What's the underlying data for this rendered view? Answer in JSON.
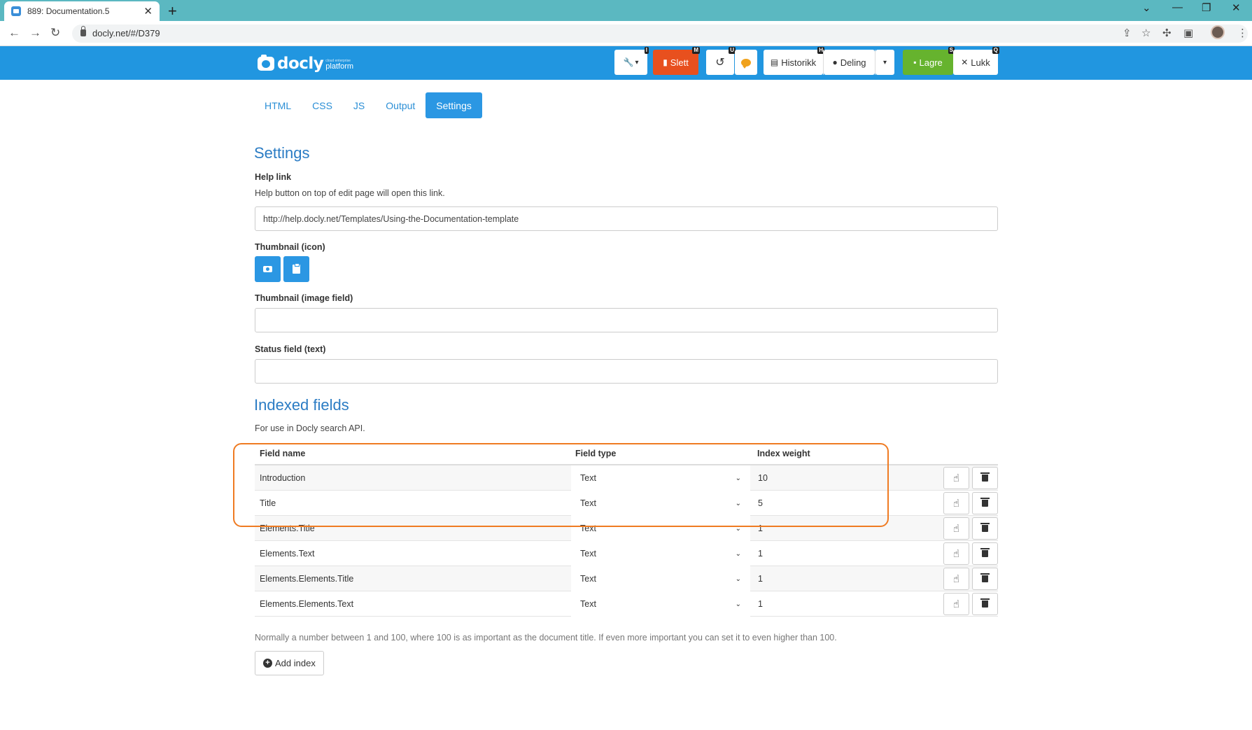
{
  "browser": {
    "tab_title": "889: Documentation.5",
    "tab_close": "✕",
    "new_tab": "+",
    "url": "docly.net/#/D379",
    "window_controls": [
      "⌄",
      "—",
      "❐",
      "✕"
    ],
    "nav": {
      "back": "←",
      "forward": "→",
      "reload": "↻"
    },
    "omni_icons": {
      "share": "⇪",
      "bookmark": "☆",
      "extensions": "✣",
      "sidepanel": "▣",
      "menu": "⋮"
    }
  },
  "app": {
    "logo": {
      "name": "docly",
      "small": "cloud enterprise",
      "platform": "platform"
    },
    "toolbar": {
      "tools": {
        "icon": "🔧",
        "caret": "▾",
        "shortcut": "I"
      },
      "delete": {
        "label": "Slett",
        "shortcut": "M"
      },
      "undo": {
        "icon": "↺",
        "shortcut": "U"
      },
      "comments": {
        "icon": "comment-icon"
      },
      "history": {
        "label": "Historikk",
        "shortcut": "H"
      },
      "share": {
        "label": "Deling"
      },
      "share_caret": "▾",
      "save": {
        "label": "Lagre",
        "shortcut": "S"
      },
      "close": {
        "label": "Lukk",
        "shortcut": "Q",
        "icon": "✕"
      }
    },
    "colors": {
      "header": "#2196e0",
      "delete": "#e8501e",
      "save": "#66b32e",
      "accent": "#2b97e3",
      "highlight": "#ef7b22"
    }
  },
  "subtabs": [
    "HTML",
    "CSS",
    "JS",
    "Output",
    "Settings"
  ],
  "active_subtab": "Settings",
  "settings": {
    "heading": "Settings",
    "help_link_label": "Help link",
    "help_link_desc": "Help button on top of edit page will open this link.",
    "help_link_value": "http://help.docly.net/Templates/Using-the-Documentation-template",
    "thumb_icon_label": "Thumbnail (icon)",
    "thumb_image_label": "Thumbnail (image field)",
    "thumb_image_value": "",
    "status_label": "Status field (text)",
    "status_value": ""
  },
  "indexed": {
    "heading": "Indexed fields",
    "desc": "For use in Docly search API.",
    "columns": {
      "name": "Field name",
      "type": "Field type",
      "weight": "Index weight"
    },
    "rows": [
      {
        "name": "Introduction",
        "type": "Text",
        "weight": "10"
      },
      {
        "name": "Title",
        "type": "Text",
        "weight": "5"
      },
      {
        "name": "Elements.Title",
        "type": "Text",
        "weight": "1"
      },
      {
        "name": "Elements.Text",
        "type": "Text",
        "weight": "1"
      },
      {
        "name": "Elements.Elements.Title",
        "type": "Text",
        "weight": "1"
      },
      {
        "name": "Elements.Elements.Text",
        "type": "Text",
        "weight": "1"
      }
    ],
    "note": "Normally a number between 1 and 100, where 100 is as important as the document title. If even more important you can set it to even higher than 100.",
    "add_label": "Add index"
  }
}
